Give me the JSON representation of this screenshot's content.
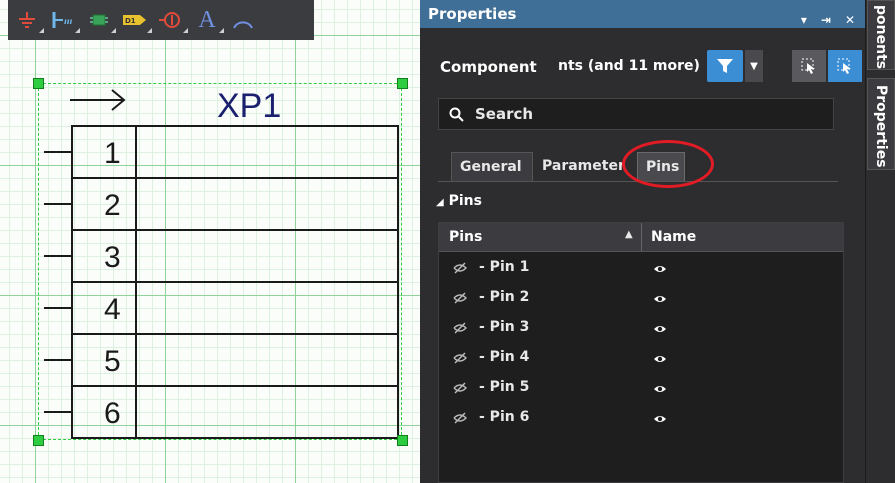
{
  "toolbar": {
    "icons": [
      "ground-icon",
      "bus-entry-icon",
      "part-icon",
      "net-label-icon",
      "directive-icon",
      "text-icon",
      "arc-icon"
    ],
    "text_tool_glyph": "A",
    "net_label_glyph": "D1"
  },
  "schematic": {
    "designator": "XP1",
    "pin_numbers": [
      "1",
      "2",
      "3",
      "4",
      "5",
      "6"
    ],
    "line_color": "#1a1a1a",
    "designator_color": "#1a1f6e",
    "selection_color": "#2ecc40"
  },
  "properties": {
    "title": "Properties",
    "title_controls": [
      "▾",
      "⇥",
      "✕"
    ],
    "component_label": "Component",
    "component_extra": "nts (and 11 more)",
    "search_placeholder": "Search",
    "tabs": [
      "General",
      "Parameter",
      "Pins"
    ],
    "active_tab": "Pins",
    "section_label": "Pins",
    "columns": {
      "pins": "Pins",
      "name": "Name"
    },
    "pins": [
      {
        "label": "- Pin 1"
      },
      {
        "label": "- Pin 2"
      },
      {
        "label": "- Pin 3"
      },
      {
        "label": "- Pin 4"
      },
      {
        "label": "- Pin 5"
      },
      {
        "label": "- Pin 6"
      }
    ],
    "accent_color": "#3b8ed4",
    "highlight_color": "#e21b25"
  },
  "side_tabs": [
    "ponents",
    "Properties"
  ]
}
